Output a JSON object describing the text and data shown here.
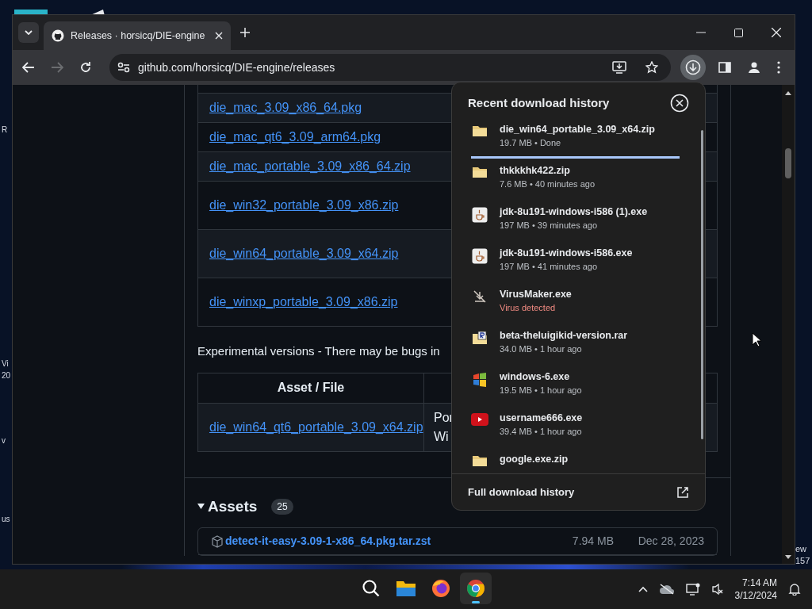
{
  "desktop": {
    "left_labels": [
      "R",
      "Vi",
      "20",
      "v",
      "us"
    ],
    "right_labels": [
      "ew",
      "157"
    ]
  },
  "browser": {
    "tab": {
      "title": "Releases · horsicq/DIE-engine",
      "selected": true
    },
    "address": "github.com/horsicq/DIE-engine/releases",
    "forward_disabled": true,
    "downloads_open": true
  },
  "page": {
    "table_rows": [
      "die_mac_3.09_x86_64.pkg",
      "die_mac_qt6_3.09_arm64.pkg",
      "die_mac_portable_3.09_x86_64.zip",
      "die_win32_portable_3.09_x86.zip",
      "die_win64_portable_3.09_x64.zip",
      "die_winxp_portable_3.09_x86.zip"
    ],
    "experimental_note": "Experimental versions - There may be bugs in",
    "experimental_table": {
      "columns": [
        "Asset / File"
      ],
      "rows": [
        {
          "file": "die_win64_qt6_portable_3.09_x64.zip",
          "column_2": [
            "Por",
            "Wi"
          ]
        }
      ]
    },
    "assets": {
      "title": "Assets",
      "count": "25",
      "expanded": true,
      "rows": [
        {
          "name": "detect-it-easy-3.09-1-x86_64.pkg.tar.zst",
          "size": "7.94 MB",
          "date": "Dec 28, 2023"
        }
      ]
    }
  },
  "downloads": {
    "title": "Recent download history",
    "items": [
      {
        "kind": "archive",
        "name": "die_win64_portable_3.09_x64.zip",
        "detail": "19.7 MB • Done",
        "warning": false,
        "level": 1
      },
      {
        "kind": "archive",
        "name": "thkkkhk422.zip",
        "detail": "7.6 MB • 40 minutes ago",
        "warning": false
      },
      {
        "kind": "java",
        "name": "jdk-8u191-windows-i586 (1).exe",
        "detail": "197 MB • 39 minutes ago",
        "warning": false
      },
      {
        "kind": "java",
        "name": "jdk-8u191-windows-i586.exe",
        "detail": "197 MB • 41 minutes ago",
        "warning": false
      },
      {
        "kind": "blocked",
        "name": "VirusMaker.exe",
        "detail": "Virus detected",
        "warning": true
      },
      {
        "kind": "rar",
        "name": "beta-theluigikid-version.rar",
        "detail": "34.0 MB • 1 hour ago",
        "warning": false
      },
      {
        "kind": "windows",
        "name": "windows-6.exe",
        "detail": "19.5 MB • 1 hour ago",
        "warning": false
      },
      {
        "kind": "video",
        "name": "username666.exe",
        "detail": "39.4 MB • 1 hour ago",
        "warning": false
      },
      {
        "kind": "archive",
        "name": "google.exe.zip"
      }
    ],
    "footer": "Full download history"
  },
  "taskbar": {
    "apps": [
      {
        "kind": "search",
        "selected": false
      },
      {
        "kind": "files",
        "selected": false
      },
      {
        "kind": "firefox",
        "selected": false
      },
      {
        "kind": "chrome",
        "selected": true
      }
    ],
    "time": "7:14 AM",
    "date": "3/12/2024"
  }
}
